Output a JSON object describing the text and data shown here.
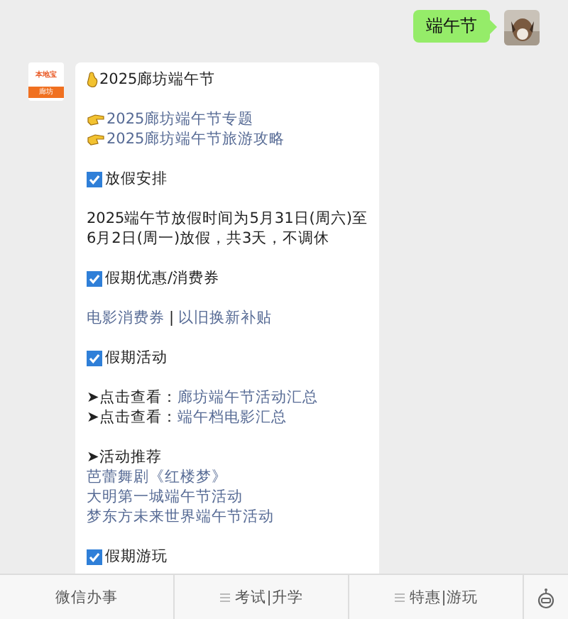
{
  "sent_message": {
    "text": "端午节"
  },
  "reply": {
    "logo": {
      "top": "本地宝",
      "bottom": "廊坊"
    },
    "groups": [
      [
        {
          "kind": "title",
          "text": "2025廊坊端午节"
        }
      ],
      [
        {
          "kind": "pointer-link",
          "text": "2025廊坊端午节专题"
        },
        {
          "kind": "pointer-link",
          "text": "2025廊坊端午节旅游攻略"
        }
      ],
      [
        {
          "kind": "check-heading",
          "text": "放假安排",
          "checked": true
        }
      ],
      [
        {
          "kind": "text",
          "text": "2025端午节放假时间为5月31日(周六)至6月2日(周一)放假，共3天，不调休"
        }
      ],
      [
        {
          "kind": "check-heading",
          "text": "假期优惠/消费券",
          "checked": true
        }
      ],
      [
        {
          "kind": "link-pair",
          "links": [
            "电影消费券",
            "以旧换新补贴"
          ],
          "separator": "|"
        }
      ],
      [
        {
          "kind": "check-heading",
          "text": "假期活动",
          "checked": true
        }
      ],
      [
        {
          "kind": "arrow-link",
          "prefix": "➤点击查看：",
          "text": "廊坊端午节活动汇总"
        },
        {
          "kind": "arrow-link",
          "prefix": "➤点击查看：",
          "text": "端午档电影汇总"
        }
      ],
      [
        {
          "kind": "text",
          "text": "➤活动推荐"
        },
        {
          "kind": "link",
          "text": "芭蕾舞剧《红楼梦》"
        },
        {
          "kind": "link",
          "text": "大明第一城端午节活动"
        },
        {
          "kind": "link",
          "text": "梦东方未来世界端午节活动"
        }
      ],
      [
        {
          "kind": "check-heading",
          "text": "假期游玩",
          "checked": true
        }
      ]
    ]
  },
  "menu": [
    {
      "text": "微信办事",
      "has_submenu": false
    },
    {
      "text": "考试|升学",
      "has_submenu": true
    },
    {
      "text": "特惠|游玩",
      "has_submenu": true
    }
  ]
}
